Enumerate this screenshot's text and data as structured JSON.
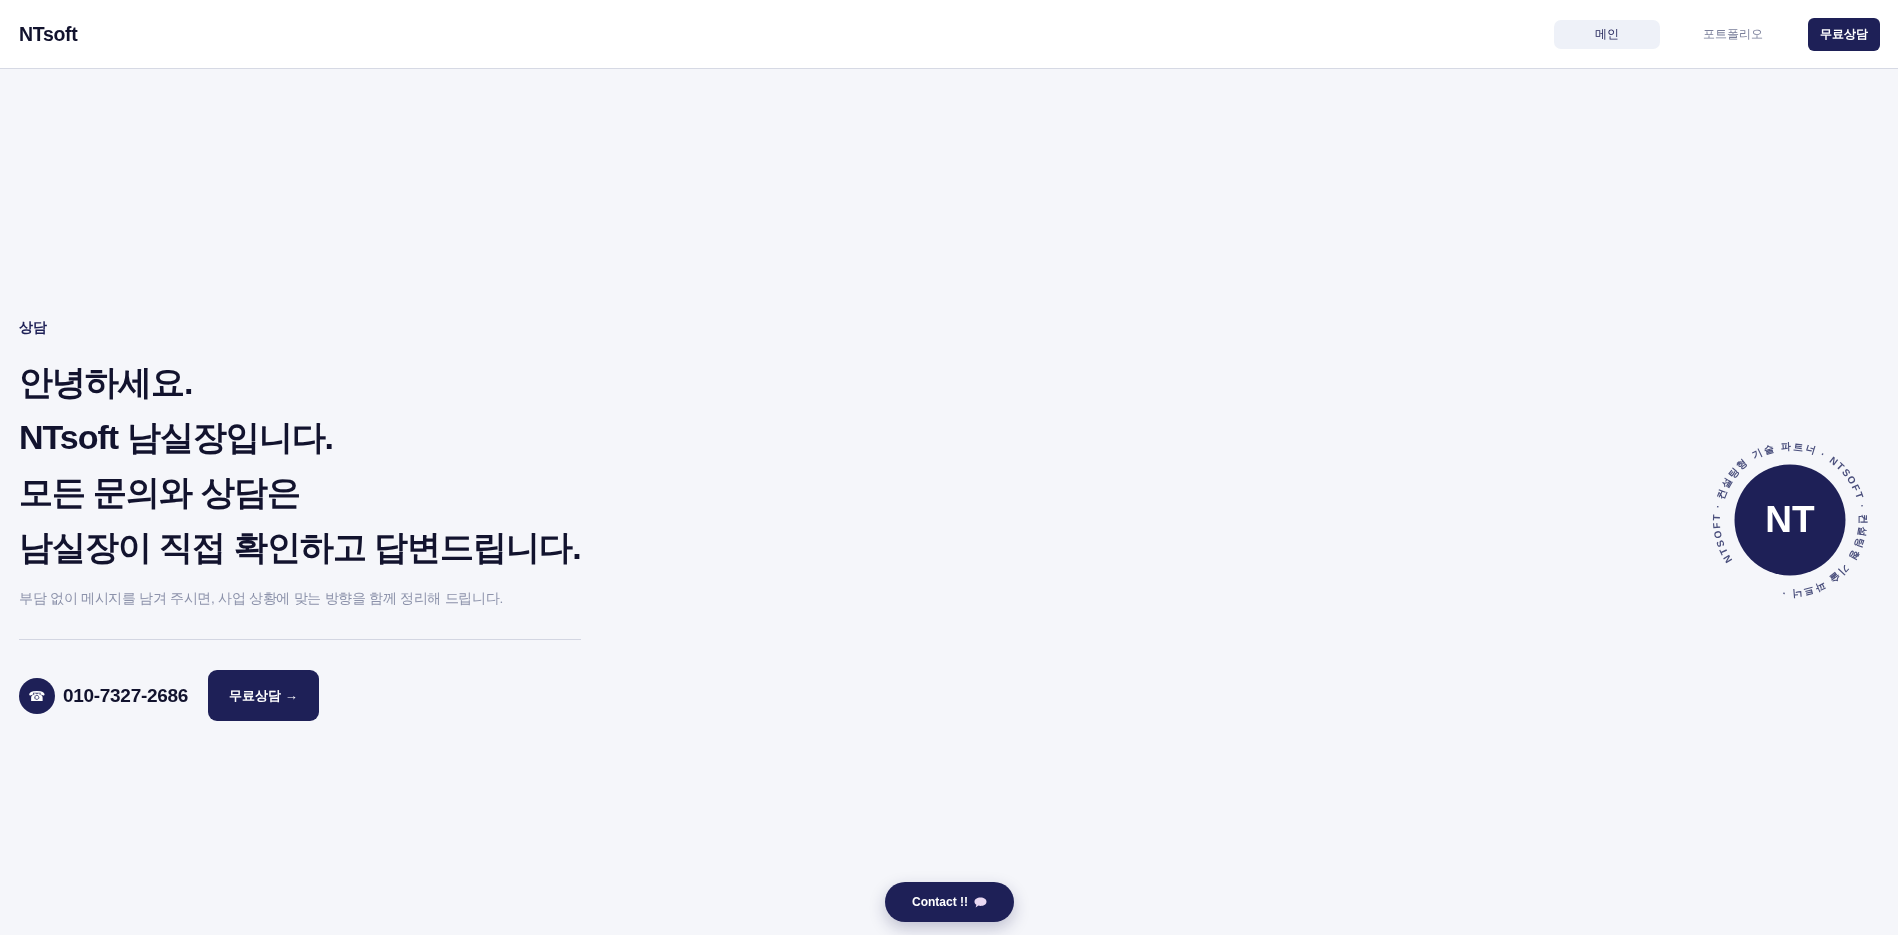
{
  "header": {
    "logo": "NTsoft",
    "nav_tabs": [
      {
        "label": "메인",
        "selected": true
      },
      {
        "label": "포트폴리오",
        "selected": false
      }
    ],
    "cta_button": "무료상담"
  },
  "hero": {
    "eyebrow": "상담",
    "heading_lines": [
      "안녕하세요.",
      "NTsoft 남실장입니다.",
      "모든 문의와 상담은",
      "남실장이 직접 확인하고 답변드립니다."
    ],
    "subtitle": "부담 없이 메시지를 남겨 주시면, 사업 상황에 맞는 방향을 함께 정리해 드립니다.",
    "phone_icon": "☎",
    "phone": "010-7327-2686",
    "consult_button": "무료상담 →"
  },
  "badge": {
    "monogram": "NT",
    "ring_text": [
      "NTSOFT · 컨설팅형",
      "기술",
      "파트너 ·",
      "NTSOFT · 컨설팅형",
      "기술",
      "파트너 ·"
    ]
  },
  "contact_button": {
    "label": "Contact !!"
  }
}
